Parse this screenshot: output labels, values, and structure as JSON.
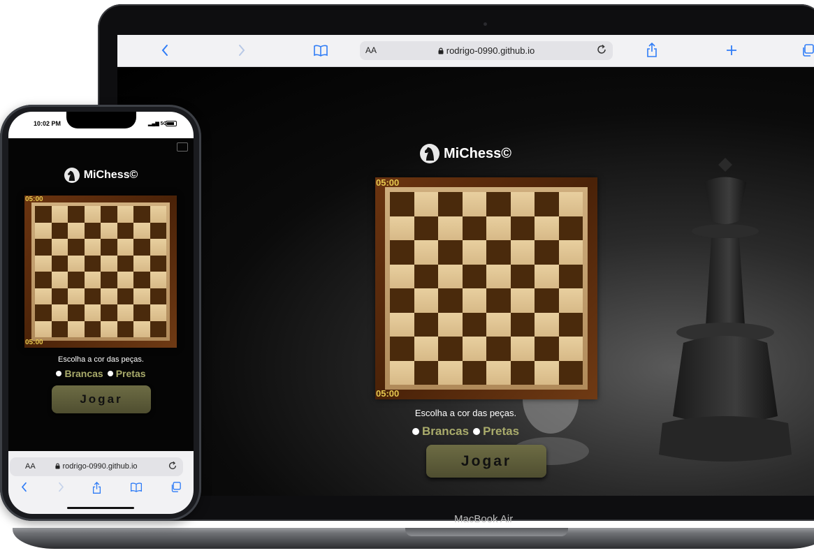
{
  "laptop": {
    "model_label": "MacBook Air",
    "browser": {
      "text_size_label": "AA",
      "url": "rodrigo-0990.github.io"
    }
  },
  "phone": {
    "status_time": "10:02 PM",
    "status_network": "5G",
    "browser": {
      "text_size_label": "AA",
      "url": "rodrigo-0990.github.io"
    }
  },
  "app": {
    "title": "MiChess©",
    "timer_top": "05:00",
    "timer_bottom": "05:00",
    "choose_color_prompt": "Escolha a cor das peças.",
    "option_white": "Brancas",
    "option_black": "Pretas",
    "play_button": "Jogar"
  },
  "colors": {
    "timer": "#e6c84f",
    "option_text": "#a9ab6b",
    "play_button": "#5e5d3b",
    "board_dark": "#4a2a0c",
    "board_light": "#e3c895",
    "browser_accent": "#2f7cf6"
  }
}
